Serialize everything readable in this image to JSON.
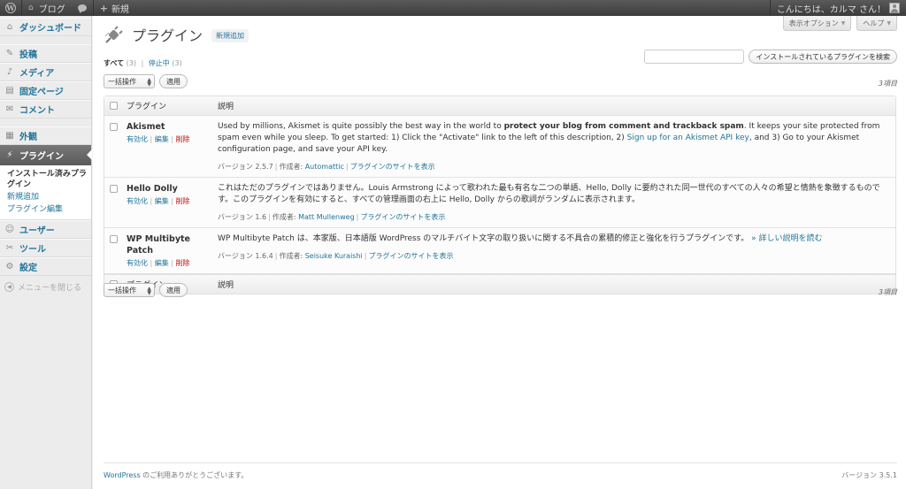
{
  "adminbar": {
    "site_name": "ブログ",
    "new_label": "新規",
    "greeting": "こんにちは、カルマ さん！"
  },
  "sidebar": {
    "items": [
      {
        "label": "ダッシュボード",
        "icon": "dashboard-icon"
      },
      {
        "label": "投稿",
        "icon": "posts-icon"
      },
      {
        "label": "メディア",
        "icon": "media-icon"
      },
      {
        "label": "固定ページ",
        "icon": "pages-icon"
      },
      {
        "label": "コメント",
        "icon": "comments-icon"
      },
      {
        "label": "外観",
        "icon": "appearance-icon"
      },
      {
        "label": "プラグイン",
        "icon": "plugins-icon"
      },
      {
        "label": "ユーザー",
        "icon": "users-icon"
      },
      {
        "label": "ツール",
        "icon": "tools-icon"
      },
      {
        "label": "設定",
        "icon": "settings-icon"
      }
    ],
    "submenu": [
      "インストール済みプラグイン",
      "新規追加",
      "プラグイン編集"
    ],
    "collapse_label": "メニューを閉じる"
  },
  "screen_tabs": {
    "options": "表示オプション",
    "help": "ヘルプ"
  },
  "page": {
    "title": "プラグイン",
    "add_new": "新規追加"
  },
  "filters": {
    "all_label": "すべて",
    "all_count": "(3)",
    "inactive_label": "停止中",
    "inactive_count": "(3)"
  },
  "search": {
    "button": "インストールされているプラグインを検索",
    "value": ""
  },
  "bulk": {
    "select": "一括操作",
    "apply": "適用",
    "count": "3項目"
  },
  "table": {
    "col_plugin": "プラグイン",
    "col_desc": "説明",
    "actions": {
      "activate": "有効化",
      "edit": "編集",
      "delete": "削除"
    },
    "version_prefix": "バージョン",
    "author_prefix": "作成者:",
    "site_label": "プラグインのサイトを表示",
    "rows": [
      {
        "name": "Akismet",
        "desc_1": "Used by millions, Akismet is quite possibly the best way in the world to ",
        "desc_bold": "protect your blog from comment and trackback spam",
        "desc_2": ". It keeps your site protected from spam even while you sleep. To get started: 1) Click the \"Activate\" link to the left of this description, 2) ",
        "desc_link": "Sign up for an Akismet API key",
        "desc_3": ", and 3) Go to your Akismet configuration page, and save your API key.",
        "version": "2.5.7",
        "author": "Automattic"
      },
      {
        "name": "Hello Dolly",
        "desc_1": "これはただのプラグインではありません。Louis Armstrong によって歌われた最も有名な二つの単語、Hello, Dolly に要約された同一世代のすべての人々の希望と情熱を象徴するものです。このプラグインを有効にすると、すべての管理画面の右上に Hello, Dolly からの歌詞がランダムに表示されます。",
        "version": "1.6",
        "author": "Matt Mullenweg"
      },
      {
        "name": "WP Multibyte Patch",
        "desc_1": "WP Multibyte Patch は、本家版、日本語版 WordPress のマルチバイト文字の取り扱いに関する不具合の累積的修正と強化を行うプラグインです。",
        "desc_link": "» 詳しい説明を読む",
        "version": "1.6.4",
        "author": "Seisuke Kuraishi"
      }
    ]
  },
  "footer": {
    "link": "WordPress",
    "thanks": " のご利用ありがとうございます。",
    "version": "バージョン 3.5.1"
  }
}
